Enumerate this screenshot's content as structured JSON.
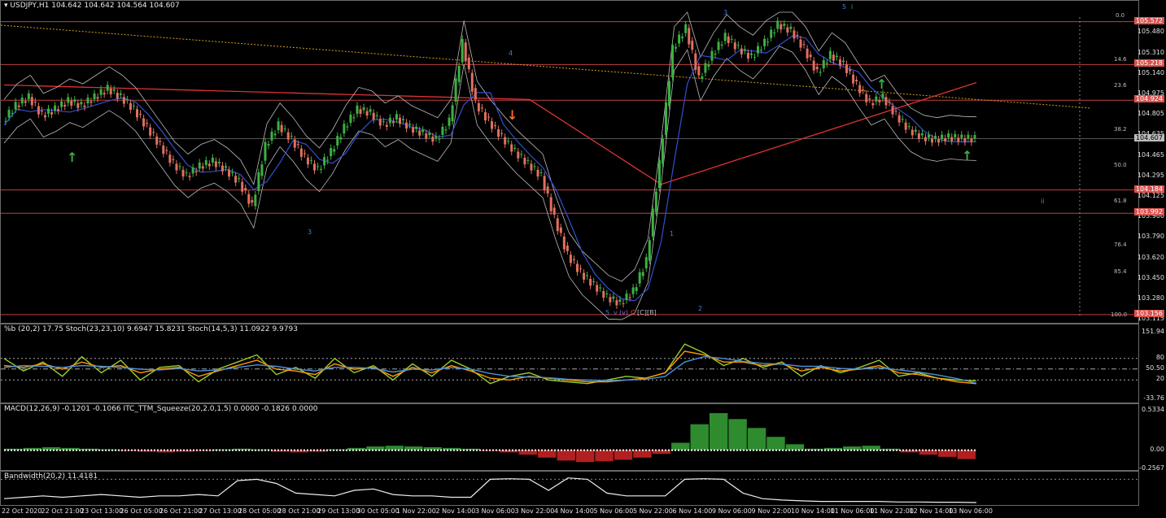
{
  "chart_data": [
    {
      "type": "line",
      "title": "USDJPY,H1",
      "ohlc": {
        "open": "104.642",
        "high": "104.642",
        "low": "104.564",
        "close": "104.607"
      },
      "y_ticks": [
        "105.480",
        "105.310",
        "105.140",
        "104.975",
        "104.805",
        "104.635",
        "104.465",
        "104.295",
        "104.125",
        "103.960",
        "103.790",
        "103.620",
        "103.450",
        "103.280",
        "103.115"
      ],
      "ylim": [
        103.115,
        105.65
      ],
      "price_levels": [
        {
          "label": "105.572",
          "value": 105.572,
          "color": "#d9534f"
        },
        {
          "label": "105.218",
          "value": 105.218,
          "color": "#d9534f"
        },
        {
          "label": "104.924",
          "value": 104.924,
          "color": "#d9534f"
        },
        {
          "label": "104.607",
          "value": 104.607,
          "color": "#bbbbbb"
        },
        {
          "label": "104.184",
          "value": 104.184,
          "color": "#d9534f"
        },
        {
          "label": "103.992",
          "value": 103.992,
          "color": "#d9534f"
        },
        {
          "label": "103.156",
          "value": 103.156,
          "color": "#d9534f"
        }
      ],
      "fib_levels": [
        "0.0",
        "14.6",
        "23.6",
        "38.2",
        "50.0",
        "61.8",
        "76.4",
        "85.4",
        "100.0"
      ],
      "wave_labels": [
        "3",
        "4",
        "3",
        "5",
        "1",
        "2",
        "5",
        "v",
        "(v)",
        "C",
        "[C]",
        "[B]",
        "ii",
        "i"
      ],
      "close_series": {
        "x": [
          0,
          4,
          8,
          12,
          16,
          20,
          24,
          28,
          32,
          36,
          40,
          44,
          48,
          52,
          56,
          60,
          64,
          68,
          72,
          76,
          80,
          84,
          88,
          92,
          96,
          100,
          104,
          108,
          112,
          116,
          120,
          124,
          128,
          132,
          136,
          140,
          144,
          148,
          152,
          156,
          160,
          164,
          168,
          172,
          176,
          180,
          184,
          188,
          192,
          196,
          200,
          204,
          208,
          212,
          216,
          220,
          224,
          228,
          232,
          236,
          240,
          244,
          248,
          252,
          256,
          260,
          264,
          268,
          272,
          276,
          280,
          284,
          288,
          292,
          296
        ],
        "close": [
          104.75,
          104.88,
          104.95,
          104.8,
          104.85,
          104.92,
          104.88,
          104.95,
          105.02,
          104.95,
          104.85,
          104.7,
          104.55,
          104.4,
          104.3,
          104.38,
          104.42,
          104.35,
          104.25,
          104.05,
          104.55,
          104.72,
          104.6,
          104.45,
          104.35,
          104.5,
          104.7,
          104.85,
          104.82,
          104.72,
          104.78,
          104.7,
          104.65,
          104.6,
          104.75,
          105.4,
          104.9,
          104.75,
          104.62,
          104.5,
          104.4,
          104.3,
          103.95,
          103.65,
          103.5,
          103.4,
          103.3,
          103.25,
          103.35,
          103.6,
          104.4,
          105.35,
          105.52,
          105.1,
          105.3,
          105.45,
          105.35,
          105.28,
          105.4,
          105.55,
          105.5,
          105.35,
          105.15,
          105.3,
          105.22,
          105.05,
          104.9,
          104.95,
          104.8,
          104.68,
          104.62,
          104.6,
          104.62,
          104.61,
          104.607
        ]
      },
      "x_ticks": [
        "22 Oct 2020",
        "22 Oct 21:00",
        "23 Oct 13:00",
        "26 Oct 05:00",
        "26 Oct 21:00",
        "27 Oct 13:00",
        "28 Oct 05:00",
        "28 Oct 21:00",
        "29 Oct 13:00",
        "30 Oct 05:00",
        "1 Nov 22:00",
        "2 Nov 14:00",
        "3 Nov 06:00",
        "3 Nov 22:00",
        "4 Nov 14:00",
        "5 Nov 06:00",
        "5 Nov 22:00",
        "6 Nov 14:00",
        "9 Nov 06:00",
        "9 Nov 22:00",
        "10 Nov 14:00",
        "11 Nov 06:00",
        "11 Nov 22:00",
        "12 Nov 14:00",
        "13 Nov 06:00"
      ]
    },
    {
      "type": "line",
      "title": "%b (20,2) 17.75  Stoch(23,23,10) 9.6947 15.8231  Stoch(14,5,3) 11.0922 9.9793",
      "y_ticks": [
        "151.94",
        "80",
        "50.50",
        "20",
        "-33.76"
      ],
      "ylim": [
        -33.76,
        151.94
      ],
      "series": [
        {
          "name": "%b",
          "color": "#9acd32",
          "values": [
            80,
            45,
            70,
            30,
            85,
            40,
            75,
            20,
            55,
            60,
            15,
            50,
            70,
            90,
            35,
            55,
            25,
            80,
            40,
            60,
            20,
            65,
            30,
            75,
            50,
            10,
            30,
            40,
            20,
            15,
            10,
            20,
            30,
            25,
            40,
            120,
            95,
            60,
            80,
            55,
            70,
            30,
            60,
            40,
            55,
            75,
            30,
            40,
            25,
            20,
            17.75
          ]
        },
        {
          "name": "Stoch(23,23,10)",
          "color": "#ff9900",
          "values": [
            60,
            55,
            65,
            50,
            70,
            55,
            60,
            40,
            50,
            55,
            30,
            45,
            60,
            75,
            50,
            45,
            35,
            65,
            50,
            55,
            30,
            55,
            40,
            60,
            45,
            25,
            20,
            30,
            25,
            20,
            15,
            15,
            20,
            25,
            40,
            100,
            90,
            70,
            70,
            60,
            65,
            45,
            55,
            45,
            50,
            60,
            40,
            35,
            25,
            15,
            9.69
          ]
        },
        {
          "name": "Stoch(14,5,3)",
          "color": "#4a90d9",
          "values": [
            55,
            60,
            58,
            55,
            60,
            58,
            55,
            50,
            48,
            52,
            45,
            48,
            55,
            62,
            58,
            50,
            45,
            55,
            55,
            52,
            42,
            50,
            48,
            55,
            50,
            38,
            30,
            28,
            26,
            22,
            20,
            18,
            20,
            22,
            30,
            70,
            85,
            80,
            72,
            66,
            64,
            58,
            58,
            52,
            50,
            54,
            48,
            42,
            34,
            24,
            11.09
          ]
        }
      ]
    },
    {
      "type": "bar",
      "title": "MACD(12,26,9) -0.1201 -0.1066  ITC_TTM_Squeeze(20,2.0,1.5) 0.0000 -0.1826 0.0000",
      "y_ticks": [
        "0.5334",
        "0.00",
        "-0.2567"
      ],
      "ylim": [
        -0.2567,
        0.5334
      ],
      "values": [
        0.02,
        0.03,
        0.04,
        0.03,
        0.02,
        0.01,
        -0.01,
        -0.02,
        -0.03,
        -0.02,
        -0.01,
        0.01,
        0.02,
        0.01,
        -0.02,
        -0.03,
        -0.02,
        0.01,
        0.03,
        0.05,
        0.06,
        0.05,
        0.04,
        0.03,
        0.02,
        -0.01,
        -0.03,
        -0.06,
        -0.1,
        -0.14,
        -0.16,
        -0.15,
        -0.13,
        -0.1,
        -0.05,
        0.1,
        0.35,
        0.5,
        0.42,
        0.3,
        0.18,
        0.08,
        0.02,
        0.03,
        0.05,
        0.06,
        0.02,
        -0.03,
        -0.06,
        -0.09,
        -0.12
      ]
    },
    {
      "type": "line",
      "title": "Bandwidth(20,2) 11.4181",
      "values": [
        0.2,
        0.25,
        0.3,
        0.25,
        0.3,
        0.35,
        0.3,
        0.25,
        0.3,
        0.3,
        0.35,
        0.3,
        0.85,
        0.9,
        0.75,
        0.4,
        0.35,
        0.3,
        0.5,
        0.55,
        0.35,
        0.3,
        0.3,
        0.25,
        0.25,
        0.9,
        0.92,
        0.9,
        0.5,
        0.95,
        0.9,
        0.4,
        0.3,
        0.3,
        0.3,
        0.9,
        0.92,
        0.9,
        0.4,
        0.2,
        0.15,
        0.12,
        0.1,
        0.1,
        0.1,
        0.1,
        0.08,
        0.08,
        0.07,
        0.07,
        0.06
      ]
    }
  ]
}
